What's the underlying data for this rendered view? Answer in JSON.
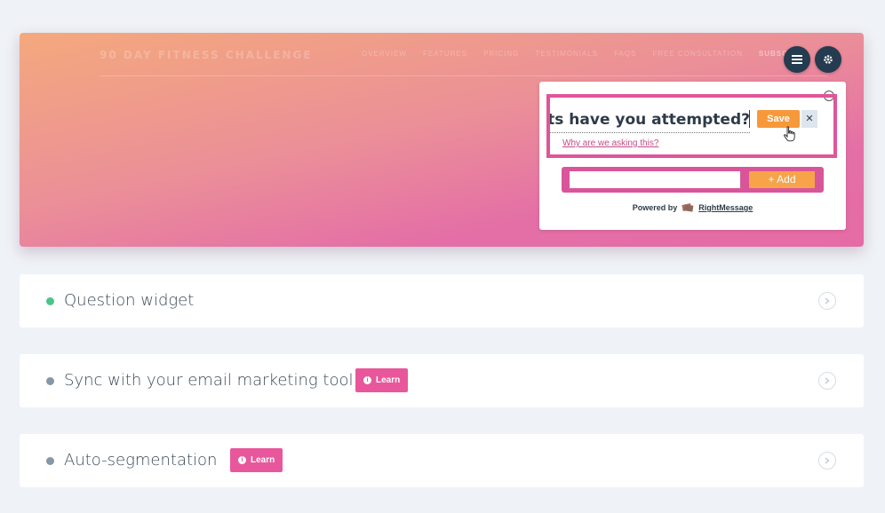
{
  "site": {
    "title": "90 DAY FITNESS CHALLENGE",
    "nav": [
      "OVERVIEW",
      "FEATURES",
      "PRICING",
      "TESTIMONIALS",
      "FAQS",
      "FREE CONSULTATION"
    ],
    "subscribe": "SUBSCRIBE"
  },
  "toolbar": {
    "menu_icon": "hamburger-icon",
    "settings_icon": "gear-icon"
  },
  "widget": {
    "close_symbol": "×",
    "question_text": "...ets have you attempted?",
    "save_label": "Save",
    "dismiss_symbol": "✕",
    "why_link": "Why are we asking this?",
    "add_input_value": "",
    "add_label": "+ Add",
    "powered_by": "Powered by",
    "brand": "RightMessage"
  },
  "cards": [
    {
      "label": "Question widget",
      "status_color": "#4cc38a",
      "learn": null
    },
    {
      "label": "Sync with your email marketing tool",
      "status_color": "#8697a5",
      "learn": "Learn"
    },
    {
      "label": "Auto-segmentation",
      "status_color": "#8697a5",
      "learn": "Learn"
    }
  ],
  "colors": {
    "accent_pink": "#e8579b",
    "accent_orange": "#f7993a",
    "dark_navy": "#253b4f"
  }
}
